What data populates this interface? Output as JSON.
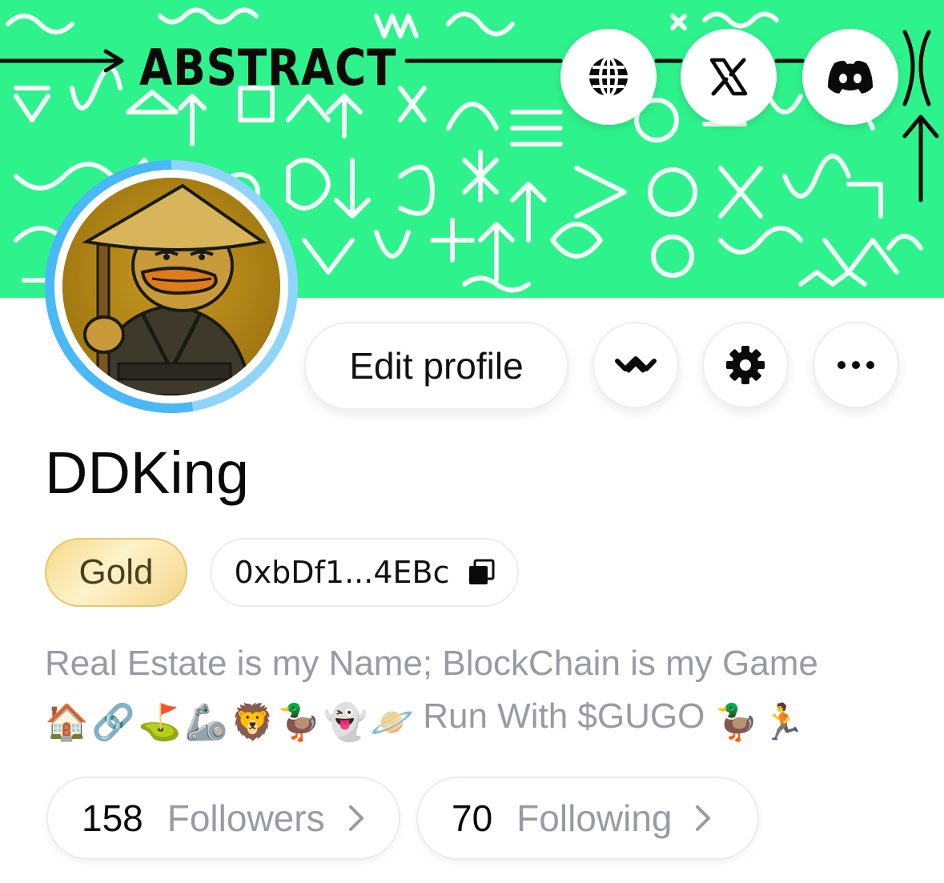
{
  "banner": {
    "brand": "ABSTRACT",
    "background_color": "#2ef38c"
  },
  "social_links": [
    {
      "name": "website",
      "icon": "globe-icon"
    },
    {
      "name": "x",
      "icon": "x-logo-icon"
    },
    {
      "name": "discord",
      "icon": "discord-icon"
    }
  ],
  "avatar": {
    "description": "avatar-image",
    "ring_color": "#49b8f5"
  },
  "actions": {
    "edit_profile_label": "Edit profile",
    "wallet_icon": "walletconnect-icon",
    "settings_icon": "gear-icon",
    "more_icon": "ellipsis-icon"
  },
  "profile": {
    "username": "DDKing",
    "tier": "Gold",
    "address": "0xbDf1...4EBc",
    "copy_icon": "copy-icon",
    "bio_line1": "Real Estate is my Name; BlockChain is my Game",
    "bio_emojis": [
      "🏠",
      "🔗",
      "⛳",
      "🦾",
      "🦁",
      "🦆",
      "👻",
      "🪐"
    ],
    "bio_text2": "Run With $GUGO",
    "bio_emojis_end": [
      "🦆",
      "🏃"
    ]
  },
  "stats": {
    "followers_count": "158",
    "followers_label": "Followers",
    "following_count": "70",
    "following_label": "Following"
  }
}
